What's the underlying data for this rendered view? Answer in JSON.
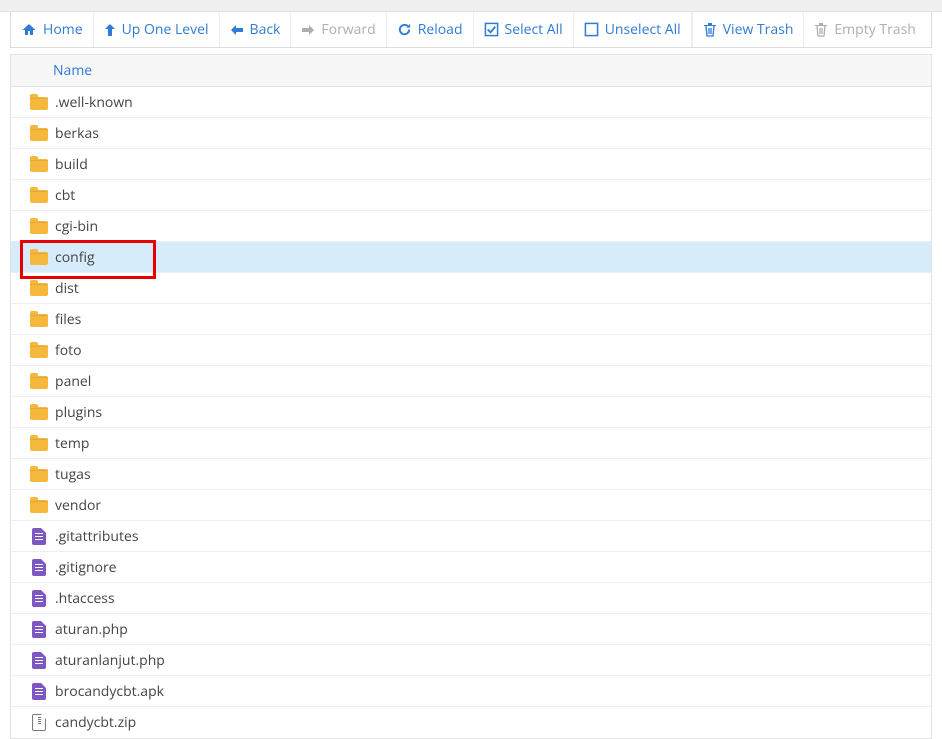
{
  "toolbar": {
    "home": "Home",
    "up": "Up One Level",
    "back": "Back",
    "forward": "Forward",
    "reload": "Reload",
    "select_all": "Select All",
    "unselect_all": "Unselect All",
    "view_trash": "View Trash",
    "empty_trash": "Empty Trash"
  },
  "header": {
    "name": "Name"
  },
  "items": [
    {
      "type": "folder",
      "name": ".well-known",
      "selected": false,
      "highlighted": false
    },
    {
      "type": "folder",
      "name": "berkas",
      "selected": false,
      "highlighted": false
    },
    {
      "type": "folder",
      "name": "build",
      "selected": false,
      "highlighted": false
    },
    {
      "type": "folder",
      "name": "cbt",
      "selected": false,
      "highlighted": false
    },
    {
      "type": "folder",
      "name": "cgi-bin",
      "selected": false,
      "highlighted": false
    },
    {
      "type": "folder",
      "name": "config",
      "selected": true,
      "highlighted": true
    },
    {
      "type": "folder",
      "name": "dist",
      "selected": false,
      "highlighted": false
    },
    {
      "type": "folder",
      "name": "files",
      "selected": false,
      "highlighted": false
    },
    {
      "type": "folder",
      "name": "foto",
      "selected": false,
      "highlighted": false
    },
    {
      "type": "folder",
      "name": "panel",
      "selected": false,
      "highlighted": false
    },
    {
      "type": "folder",
      "name": "plugins",
      "selected": false,
      "highlighted": false
    },
    {
      "type": "folder",
      "name": "temp",
      "selected": false,
      "highlighted": false
    },
    {
      "type": "folder",
      "name": "tugas",
      "selected": false,
      "highlighted": false
    },
    {
      "type": "folder",
      "name": "vendor",
      "selected": false,
      "highlighted": false
    },
    {
      "type": "doc",
      "name": ".gitattributes",
      "selected": false,
      "highlighted": false
    },
    {
      "type": "doc",
      "name": ".gitignore",
      "selected": false,
      "highlighted": false
    },
    {
      "type": "doc",
      "name": ".htaccess",
      "selected": false,
      "highlighted": false
    },
    {
      "type": "doc",
      "name": "aturan.php",
      "selected": false,
      "highlighted": false
    },
    {
      "type": "doc",
      "name": "aturanlanjut.php",
      "selected": false,
      "highlighted": false
    },
    {
      "type": "doc",
      "name": "brocandycbt.apk",
      "selected": false,
      "highlighted": false
    },
    {
      "type": "zip",
      "name": "candycbt.zip",
      "selected": false,
      "highlighted": false
    }
  ]
}
